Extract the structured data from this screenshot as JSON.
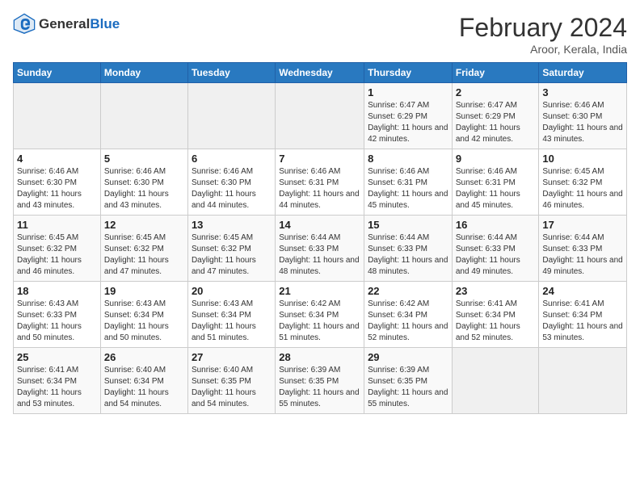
{
  "header": {
    "logo": {
      "general": "General",
      "blue": "Blue"
    },
    "title": "February 2024",
    "location": "Aroor, Kerala, India"
  },
  "calendar": {
    "weekdays": [
      "Sunday",
      "Monday",
      "Tuesday",
      "Wednesday",
      "Thursday",
      "Friday",
      "Saturday"
    ],
    "weeks": [
      [
        {
          "day": "",
          "info": ""
        },
        {
          "day": "",
          "info": ""
        },
        {
          "day": "",
          "info": ""
        },
        {
          "day": "",
          "info": ""
        },
        {
          "day": "1",
          "info": "Sunrise: 6:47 AM\nSunset: 6:29 PM\nDaylight: 11 hours and 42 minutes."
        },
        {
          "day": "2",
          "info": "Sunrise: 6:47 AM\nSunset: 6:29 PM\nDaylight: 11 hours and 42 minutes."
        },
        {
          "day": "3",
          "info": "Sunrise: 6:46 AM\nSunset: 6:30 PM\nDaylight: 11 hours and 43 minutes."
        }
      ],
      [
        {
          "day": "4",
          "info": "Sunrise: 6:46 AM\nSunset: 6:30 PM\nDaylight: 11 hours and 43 minutes."
        },
        {
          "day": "5",
          "info": "Sunrise: 6:46 AM\nSunset: 6:30 PM\nDaylight: 11 hours and 43 minutes."
        },
        {
          "day": "6",
          "info": "Sunrise: 6:46 AM\nSunset: 6:30 PM\nDaylight: 11 hours and 44 minutes."
        },
        {
          "day": "7",
          "info": "Sunrise: 6:46 AM\nSunset: 6:31 PM\nDaylight: 11 hours and 44 minutes."
        },
        {
          "day": "8",
          "info": "Sunrise: 6:46 AM\nSunset: 6:31 PM\nDaylight: 11 hours and 45 minutes."
        },
        {
          "day": "9",
          "info": "Sunrise: 6:46 AM\nSunset: 6:31 PM\nDaylight: 11 hours and 45 minutes."
        },
        {
          "day": "10",
          "info": "Sunrise: 6:45 AM\nSunset: 6:32 PM\nDaylight: 11 hours and 46 minutes."
        }
      ],
      [
        {
          "day": "11",
          "info": "Sunrise: 6:45 AM\nSunset: 6:32 PM\nDaylight: 11 hours and 46 minutes."
        },
        {
          "day": "12",
          "info": "Sunrise: 6:45 AM\nSunset: 6:32 PM\nDaylight: 11 hours and 47 minutes."
        },
        {
          "day": "13",
          "info": "Sunrise: 6:45 AM\nSunset: 6:32 PM\nDaylight: 11 hours and 47 minutes."
        },
        {
          "day": "14",
          "info": "Sunrise: 6:44 AM\nSunset: 6:33 PM\nDaylight: 11 hours and 48 minutes."
        },
        {
          "day": "15",
          "info": "Sunrise: 6:44 AM\nSunset: 6:33 PM\nDaylight: 11 hours and 48 minutes."
        },
        {
          "day": "16",
          "info": "Sunrise: 6:44 AM\nSunset: 6:33 PM\nDaylight: 11 hours and 49 minutes."
        },
        {
          "day": "17",
          "info": "Sunrise: 6:44 AM\nSunset: 6:33 PM\nDaylight: 11 hours and 49 minutes."
        }
      ],
      [
        {
          "day": "18",
          "info": "Sunrise: 6:43 AM\nSunset: 6:33 PM\nDaylight: 11 hours and 50 minutes."
        },
        {
          "day": "19",
          "info": "Sunrise: 6:43 AM\nSunset: 6:34 PM\nDaylight: 11 hours and 50 minutes."
        },
        {
          "day": "20",
          "info": "Sunrise: 6:43 AM\nSunset: 6:34 PM\nDaylight: 11 hours and 51 minutes."
        },
        {
          "day": "21",
          "info": "Sunrise: 6:42 AM\nSunset: 6:34 PM\nDaylight: 11 hours and 51 minutes."
        },
        {
          "day": "22",
          "info": "Sunrise: 6:42 AM\nSunset: 6:34 PM\nDaylight: 11 hours and 52 minutes."
        },
        {
          "day": "23",
          "info": "Sunrise: 6:41 AM\nSunset: 6:34 PM\nDaylight: 11 hours and 52 minutes."
        },
        {
          "day": "24",
          "info": "Sunrise: 6:41 AM\nSunset: 6:34 PM\nDaylight: 11 hours and 53 minutes."
        }
      ],
      [
        {
          "day": "25",
          "info": "Sunrise: 6:41 AM\nSunset: 6:34 PM\nDaylight: 11 hours and 53 minutes."
        },
        {
          "day": "26",
          "info": "Sunrise: 6:40 AM\nSunset: 6:34 PM\nDaylight: 11 hours and 54 minutes."
        },
        {
          "day": "27",
          "info": "Sunrise: 6:40 AM\nSunset: 6:35 PM\nDaylight: 11 hours and 54 minutes."
        },
        {
          "day": "28",
          "info": "Sunrise: 6:39 AM\nSunset: 6:35 PM\nDaylight: 11 hours and 55 minutes."
        },
        {
          "day": "29",
          "info": "Sunrise: 6:39 AM\nSunset: 6:35 PM\nDaylight: 11 hours and 55 minutes."
        },
        {
          "day": "",
          "info": ""
        },
        {
          "day": "",
          "info": ""
        }
      ]
    ]
  }
}
